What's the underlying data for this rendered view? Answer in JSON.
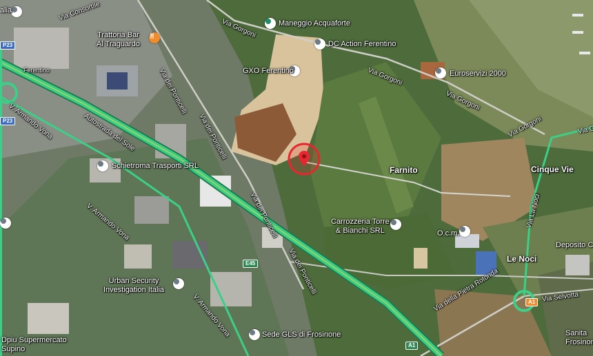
{
  "colors": {
    "motorway": "#3ccf87",
    "motorway_edge": "#1f7a4c",
    "road": "#d9d9d9",
    "selected_ring": "#e8262f",
    "pin_gray": "#6f7a87",
    "pin_green": "#1e8e6e",
    "pin_orange": "#f08c2c"
  },
  "roads": {
    "via_gorgoni_1": "Via Gorgoni",
    "via_gorgoni_2": "Via Gorgoni",
    "via_gorgoni_3": "Via Gorgoni",
    "via_gorgoni_4": "Via Gorgoni",
    "via_pontici_1": "Via dei Ponticelli",
    "via_pontici_2": "Via dei Ponticelli",
    "via_pontici_3": "Via dei Ponticelli",
    "via_pontici_4": "Via dei Ponticelli",
    "autostrada": "Autostrada del Sole",
    "v_armando_vona_1": "V. Armando Vona",
    "v_armando_vona_2": "V. Armando Vona",
    "v_armando_vona_3": "V. Armando Vona",
    "via_pietra_rotonda": "Via della Pietra Rotonda",
    "via_selvotta": "Via Selvotta",
    "via_la_noci": "Via La Noci",
    "via_consortile": "Via Consortile",
    "ferentino_road": "Ferentino",
    "via_co": "Via Co"
  },
  "shields": {
    "p23_a": "P23",
    "p23_b": "P23",
    "e45": "E45",
    "a1": "A1"
  },
  "places": {
    "farnito": "Farnito",
    "cinque_vie": "Cinque Vie",
    "le_noci": "Le Noci"
  },
  "pois": {
    "maneggio": "Maneggio Acquaforte",
    "dc_action": "DC Action Ferentino",
    "gxo": "GXO Ferentino",
    "euroservizi": "Euroservizi 2000",
    "trattoria_line1": "Trattoria Bar",
    "trattoria_line2": "Al Traguardo",
    "schietroma": "Schietroma Trasporti SRL",
    "carrozzeria_line1": "Carrozzeria Torre",
    "carrozzeria_line2": "& Bianchi SRL",
    "ocm": "O.c.m.",
    "deposito": "Deposito Co",
    "urban_line1": "Urban Security",
    "urban_line2": "Investigation Italia",
    "sede_gls": "Sede GLS di Frosinone",
    "dpiu_line1": "Dpiu Supermercato",
    "dpiu_line2": "Supino",
    "sanita_line1": "Sanita",
    "sanita_line2": "Frosinon",
    "top_left": "alia"
  },
  "icons": {
    "selected": "location-pin-icon",
    "poi": "poi-pin-icon",
    "food": "restaurant-icon"
  }
}
